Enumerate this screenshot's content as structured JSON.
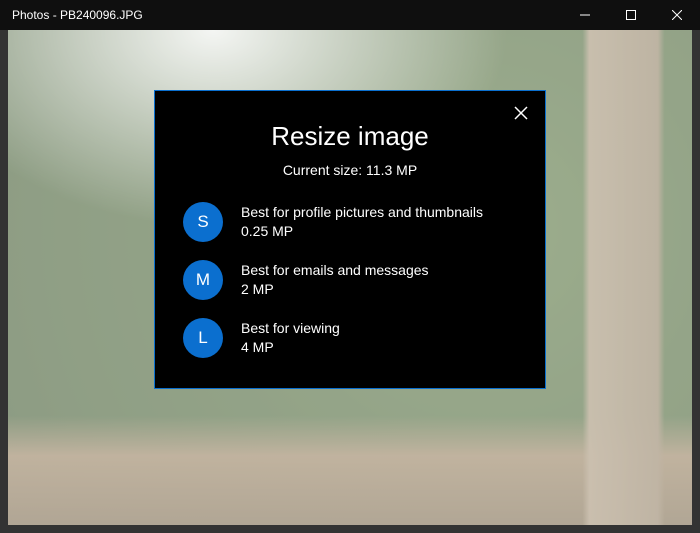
{
  "window": {
    "title": "Photos - PB240096.JPG"
  },
  "dialog": {
    "title": "Resize image",
    "current_size_label": "Current size: 11.3 MP",
    "options": [
      {
        "letter": "S",
        "desc": "Best for profile pictures and thumbnails",
        "size": "0.25 MP"
      },
      {
        "letter": "M",
        "desc": "Best for emails and messages",
        "size": "2 MP"
      },
      {
        "letter": "L",
        "desc": "Best for viewing",
        "size": "4 MP"
      }
    ]
  },
  "colors": {
    "accent": "#0b6fcf",
    "dialog_bg": "#000000",
    "dialog_border": "#0a6fcf"
  }
}
